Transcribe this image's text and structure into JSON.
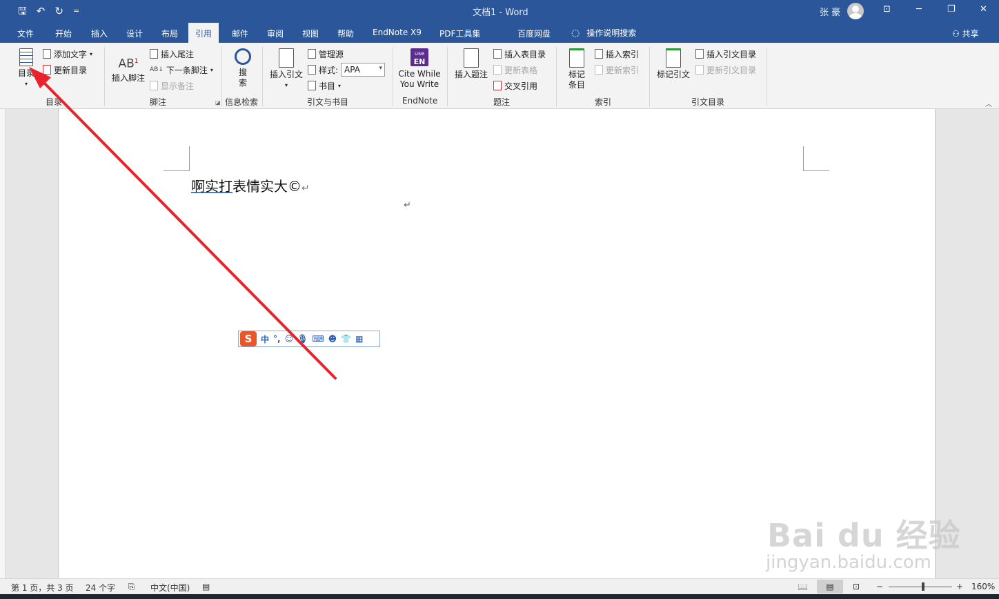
{
  "window": {
    "title": "文档1  -  Word",
    "user": "张 豪",
    "qat": {
      "save": "🖫",
      "undo": "↶",
      "redo": "↻",
      "more": "="
    },
    "controls": {
      "ribbon_display": "⊡",
      "minimize": "─",
      "restore": "❐",
      "close": "✕"
    }
  },
  "tabs": [
    {
      "label": "文件"
    },
    {
      "label": "开始"
    },
    {
      "label": "插入"
    },
    {
      "label": "设计"
    },
    {
      "label": "布局"
    },
    {
      "label": "引用"
    },
    {
      "label": "邮件"
    },
    {
      "label": "审阅"
    },
    {
      "label": "视图"
    },
    {
      "label": "帮助"
    },
    {
      "label": "EndNote X9"
    },
    {
      "label": "PDF工具集"
    },
    {
      "label": "百度网盘"
    }
  ],
  "tell_me": "操作说明搜索",
  "share": "共享",
  "ribbon": {
    "toc": {
      "group": "目录",
      "big": "目录",
      "add_text": "添加文字",
      "update": "更新目录"
    },
    "footnotes": {
      "group": "脚注",
      "insert_footnote": "插入脚注",
      "insert_endnote": "插入尾注",
      "next_footnote": "下一条脚注",
      "show_notes": "显示备注",
      "ab_glyph": "AB",
      "ab_sup": "1"
    },
    "research": {
      "group": "信息检索",
      "search_1": "搜",
      "search_2": "索"
    },
    "citations": {
      "group": "引文与书目",
      "insert_citation": "插入引文",
      "manage_sources": "管理源",
      "style_label": "样式:",
      "style_value": "APA",
      "bibliography": "书目"
    },
    "endnote": {
      "group": "EndNote",
      "cwyw_1": "Cite While",
      "cwyw_2": "You Write",
      "icon_text_1": "use",
      "icon_text_2": "EN"
    },
    "captions": {
      "group": "题注",
      "insert_caption": "插入题注",
      "insert_tof": "插入表目录",
      "update_table": "更新表格",
      "cross_ref": "交叉引用"
    },
    "index": {
      "group": "索引",
      "mark_entry_1": "标记",
      "mark_entry_2": "条目",
      "insert_index": "插入索引",
      "update_index": "更新索引"
    },
    "toa": {
      "group": "引文目录",
      "mark_citation": "标记引文",
      "insert_toa": "插入引文目录",
      "update_toa": "更新引文目录"
    }
  },
  "document": {
    "line1_underlined": "啊实打",
    "line1_rest": "表情实大©",
    "para_mark": "↵"
  },
  "ime": {
    "logo": "S",
    "lang": "中",
    "punct": "°,"
  },
  "status": {
    "page": "第 1 页，共 3 页",
    "words": "24 个字",
    "language": "中文(中国)",
    "zoom": "160%",
    "zoom_minus": "−",
    "zoom_plus": "+"
  },
  "watermark": {
    "line1": "Bai du 经验",
    "line2": "jingyan.baidu.com"
  },
  "colors": {
    "brand": "#2b579a",
    "arrow": "#e8232b"
  }
}
